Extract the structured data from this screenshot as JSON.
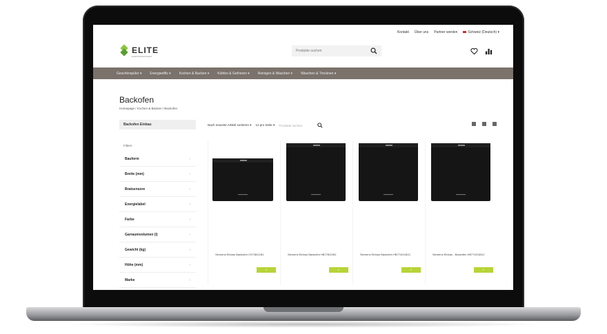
{
  "topbar": {
    "links": [
      "Kontakt",
      "Über uns",
      "Partner werden"
    ],
    "country": "Schweiz (Deutsch) ▾"
  },
  "logo": {
    "name": "ELITE",
    "tagline": "ELEKTROHAUSHALT"
  },
  "search": {
    "placeholder": "Produkte suchen"
  },
  "nav": {
    "items": [
      "Geschirrspüler ▾",
      "Energieeffiz ▾",
      "Kochen & Backen ▾",
      "Kühlen & Gefrieren ▾",
      "Reinigen & Waschen ▾",
      "Waschen & Trocknen ▾"
    ]
  },
  "page": {
    "title": "Backofen",
    "breadcrumb": "Homepage / Kochen & Backen / Backofen"
  },
  "sidebar": {
    "heading": "Backofen Einbau",
    "filter_label": "Filtern",
    "facets": [
      "Bauform",
      "Breite (mm)",
      "Bratsensore",
      "Energielabel",
      "Farbe",
      "Garraumvolumen (l)",
      "Gewicht (kg)",
      "Höhe (mm)",
      "Marke"
    ]
  },
  "toolbar": {
    "sort": "Nach neueste Artikel sortieren ▾",
    "per_page": "12 pro Seite ▾",
    "search_placeholder": "Produkte suchen"
  },
  "products": [
    {
      "name": "Siemens Einbau Backofen CS736G1B1",
      "badge": "✓"
    },
    {
      "name": "Siemens Einbau Backofen HB778G1B1",
      "badge": "✓"
    },
    {
      "name": "Siemens Einbau Backofen HB774G1B1C",
      "badge": "✓"
    },
    {
      "name": "Siemens Einbau - Backofen HB774G1B1C",
      "badge": "✓"
    }
  ],
  "colors": {
    "nav_bg": "#7a726b",
    "accent_green": "#b7d436",
    "logo_green": "#8cc63f"
  }
}
